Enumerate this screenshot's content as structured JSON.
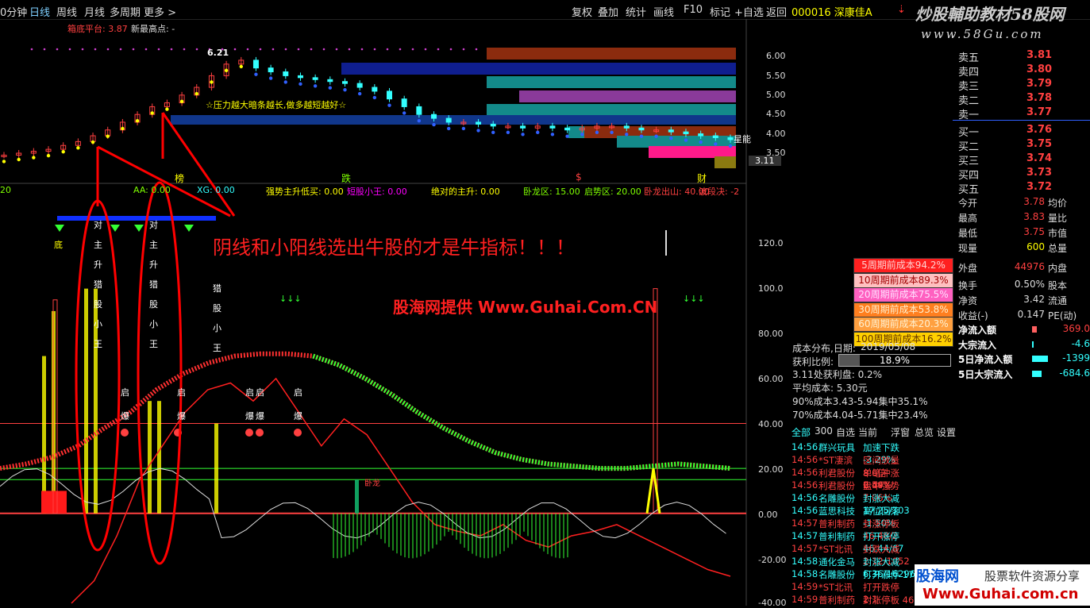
{
  "topbar": {
    "tabs": [
      "0分钟",
      "日线",
      "周线",
      "月线",
      "多周期",
      "更多 >"
    ],
    "active_tab": "日线",
    "right_buttons": [
      "复权",
      "叠加",
      "统计",
      "画线",
      "F10",
      "标记",
      "+自选",
      "返回"
    ],
    "stock_code_name": "000016 深康佳A",
    "watermark_top": "炒股輔助教材58股网",
    "watermark_url": "www.58Gu.com"
  },
  "price_panel": {
    "line1_a": "箱底平台: 3.87",
    "line1_b": "新最高点: -",
    "high_marker": "6.21",
    "callout": "☆压力越大暗条越长,做多越短越好☆",
    "current_price_tag": "3.11",
    "right_label": "星能",
    "y_ticks": [
      "6.00",
      "5.50",
      "5.00",
      "4.50",
      "4.00",
      "3.50"
    ],
    "bottom_markers": [
      "榜",
      "跌",
      "$",
      "财"
    ]
  },
  "indicator_panel": {
    "header_items": [
      {
        "text": "20",
        "color": "#7fff00"
      },
      {
        "text": "AA: 0.00",
        "color": "#7fff00"
      },
      {
        "text": "XG: 0.00",
        "color": "#3ff"
      },
      {
        "text": "强势主升低买: 0.00",
        "color": "#ff0"
      },
      {
        "text": "短股小王: 0.00",
        "color": "#f0f"
      },
      {
        "text": "绝对的主升: 0.00",
        "color": "#ff0"
      },
      {
        "text": "卧龙区: 15.00",
        "color": "#7fff00"
      },
      {
        "text": "启势区: 20.00",
        "color": "#7fff00"
      },
      {
        "text": "卧龙出山: 40.00",
        "color": "#ff4040"
      },
      {
        "text": "波段决: -2",
        "color": "#ff4040"
      }
    ],
    "y_ticks": [
      "120.0",
      "100.0",
      "80.00",
      "60.00",
      "40.00",
      "20.00",
      "0.00",
      "-20.00",
      "-40.00"
    ],
    "annotation_main": "阴线和小阳线选出牛股的才是牛指标！！！",
    "annotation_site": "股海网提供 Www.Guhai.Com.CN",
    "vertical_words": [
      "底",
      "对",
      "主",
      "升",
      "猎",
      "股",
      "小",
      "王"
    ],
    "qidong_words": [
      "启",
      "爆"
    ],
    "small_label": "卧龙"
  },
  "order_book": {
    "rows": [
      {
        "label": "卖五",
        "price": "3.81",
        "vol": ""
      },
      {
        "label": "卖四",
        "price": "3.80",
        "vol": ""
      },
      {
        "label": "卖三",
        "price": "3.79",
        "vol": ""
      },
      {
        "label": "卖二",
        "price": "3.78",
        "vol": ""
      },
      {
        "label": "卖一",
        "price": "3.77",
        "vol": ""
      },
      {
        "label": "买一",
        "price": "3.76",
        "vol": ""
      },
      {
        "label": "买二",
        "price": "3.75",
        "vol": ""
      },
      {
        "label": "买三",
        "price": "3.74",
        "vol": ""
      },
      {
        "label": "买四",
        "price": "3.73",
        "vol": ""
      },
      {
        "label": "买五",
        "price": "3.72",
        "vol": ""
      }
    ]
  },
  "quote_stats": [
    {
      "l1": "今开",
      "v1": "3.78",
      "c1": "#ff4040",
      "l2": "均价"
    },
    {
      "l1": "最高",
      "v1": "3.83",
      "c1": "#ff4040",
      "l2": "量比"
    },
    {
      "l1": "最低",
      "v1": "3.75",
      "c1": "#ff4040",
      "l2": "市值"
    },
    {
      "l1": "现量",
      "v1": "600",
      "c1": "#ff0",
      "l2": "总量"
    },
    {
      "l1": "外盘",
      "v1": "44976",
      "c1": "#ff4040",
      "l2": "内盘"
    },
    {
      "l1": "换手",
      "v1": "0.50%",
      "c1": "#ddd",
      "l2": "股本"
    },
    {
      "l1": "净资",
      "v1": "3.42",
      "c1": "#ddd",
      "l2": "流通"
    },
    {
      "l1": "收益(-)",
      "v1": "0.147",
      "c1": "#ddd",
      "l2": "PE(动)"
    }
  ],
  "cost_boxes": [
    {
      "text": "5周期前成本94.2%",
      "bg": "#ff2020",
      "fg": "#ffd0d0"
    },
    {
      "text": "10周期前成本89.3%",
      "bg": "#ffc0c0",
      "fg": "#a00000"
    },
    {
      "text": "20周期前成本75.5%",
      "bg": "#ff60c0",
      "fg": "#ffe0ff"
    },
    {
      "text": "30周期前成本53.8%",
      "bg": "#ff7f1f",
      "fg": "#fff0d0"
    },
    {
      "text": "60周期前成本20.3%",
      "bg": "#ffa040",
      "fg": "#fff0d0"
    },
    {
      "text": "100周期前成本16.2%",
      "bg": "#ffd000",
      "fg": "#603000"
    }
  ],
  "fund_flow": [
    {
      "label": "净流入额",
      "value": "369.0",
      "bar_color": "#ff6060"
    },
    {
      "label": "大宗流入",
      "value": "-4.6",
      "bar_color": "#3ff"
    },
    {
      "label": "5日净流入额",
      "value": "-1399",
      "bar_color": "#3ff"
    },
    {
      "label": "5日大宗流入",
      "value": "-684.6",
      "bar_color": "#3ff"
    }
  ],
  "cost_info": {
    "date_label": "成本分布,日期:",
    "date": "2019/05/08",
    "profit_label": "获利比例:",
    "profit_value": "18.9%",
    "profit_fraction": 0.189,
    "line3": "3.11处获利盘: 0.2%",
    "line4": "平均成本: 5.30元",
    "line5": "90%成本3.43-5.94集中35.1%",
    "line6": "70%成本4.04-5.71集中23.4%"
  },
  "news_tabs": [
    "全部",
    "300",
    "自选",
    "当前",
    "浮窗",
    "总览",
    "设置"
  ],
  "news": [
    {
      "time": "14:56",
      "name": "群兴玩具",
      "event": "加速下跌 -3.29%",
      "color": "#3ff"
    },
    {
      "time": "14:56",
      "name": "*ST凄滨",
      "event": "区间放量 8.6倍0.44%",
      "color": "#ff4040"
    },
    {
      "time": "14:56",
      "name": "利君股份",
      "event": "单笔冲涨 2.59%",
      "color": "#ff4040"
    },
    {
      "time": "14:56",
      "name": "利君股份",
      "event": "盘中强势 7.06%",
      "color": "#ff4040"
    },
    {
      "time": "14:56",
      "name": "名雕股份",
      "event": "封涨大减 17.25/103",
      "color": "#3ff"
    },
    {
      "time": "14:56",
      "name": "蓝思科技",
      "event": "高位回落 -1.50%",
      "color": "#3ff"
    },
    {
      "time": "14:57",
      "name": "普利制药",
      "event": "封涨停板 46.48/2",
      "color": "#ff4040"
    },
    {
      "time": "14:57",
      "name": "普利制药",
      "event": "打开涨停 46.44/67",
      "color": "#3ff"
    },
    {
      "time": "14:57",
      "name": "*ST北讯",
      "event": "封跌大减 2.12/1052",
      "color": "#ff4040"
    },
    {
      "time": "14:58",
      "name": "通化金马",
      "event": "封涨大减 6.36/16296",
      "color": "#3ff"
    },
    {
      "time": "14:58",
      "name": "名雕股份",
      "event": "打开涨停 17",
      "color": "#3ff"
    },
    {
      "time": "14:59",
      "name": "*ST北讯",
      "event": "打开跌停 2.1",
      "color": "#ff4040"
    },
    {
      "time": "14:59",
      "name": "普利制药",
      "event": "封涨停板 46",
      "color": "#ff4040"
    }
  ],
  "bottom_watermark": {
    "brand": "股海网",
    "slogan": "股票软件资源分享",
    "url": "Www.Guhai.com.cn"
  },
  "chart_data": {
    "type": "line",
    "title": "",
    "price_range": [
      3.0,
      6.3
    ],
    "indicator_range": [
      -40,
      130
    ],
    "price_series_approx": [
      3.45,
      3.5,
      3.55,
      3.6,
      3.7,
      3.8,
      3.95,
      4.1,
      4.3,
      4.5,
      4.7,
      4.8,
      5.0,
      5.2,
      5.5,
      5.8,
      5.9,
      5.7,
      5.6,
      5.5,
      5.45,
      5.4,
      5.35,
      5.3,
      5.2,
      5.1,
      4.9,
      4.7,
      4.5,
      4.4,
      4.3,
      4.3,
      4.25,
      4.2,
      4.2,
      4.15,
      4.2,
      4.15,
      4.1,
      4.15,
      4.2,
      4.2,
      4.15,
      4.1,
      4.1,
      4.05,
      4.0,
      3.95,
      3.9,
      3.85
    ],
    "indicator_line_approx": [
      20,
      22,
      25,
      30,
      38,
      45,
      55,
      62,
      67,
      70,
      71,
      71,
      70,
      66,
      60,
      53,
      45,
      38,
      32,
      27,
      24,
      22,
      21,
      20,
      20,
      21,
      22,
      21,
      20
    ],
    "red_line_approx": [
      -40,
      -30,
      -10,
      15,
      30,
      45,
      55,
      58,
      50,
      60,
      45,
      30,
      42,
      35,
      20,
      5,
      -5,
      -8,
      -10,
      -5,
      -12,
      -15,
      -10,
      -8,
      -5,
      -10,
      -15,
      -20,
      -25,
      -28
    ]
  }
}
